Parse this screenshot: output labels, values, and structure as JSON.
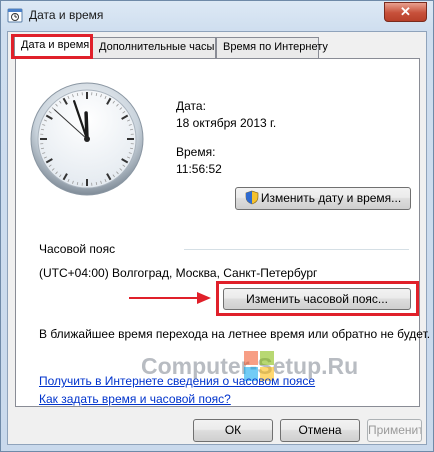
{
  "window": {
    "title": "Дата и время",
    "close_label": "✕"
  },
  "tabs": [
    {
      "label": "Дата и время",
      "active": true
    },
    {
      "label": "Дополнительные часы",
      "active": false
    },
    {
      "label": "Время по Интернету",
      "active": false
    }
  ],
  "clock": {
    "time": "11:56:52",
    "hour": 11,
    "minute": 56,
    "second": 52
  },
  "date": {
    "label": "Дата:",
    "value": "18 октября 2013 г."
  },
  "time": {
    "label": "Время:",
    "value": "11:56:52"
  },
  "buttons": {
    "change_datetime": "Изменить дату и время...",
    "change_timezone": "Изменить часовой пояс...",
    "ok": "ОК",
    "cancel": "Отмена",
    "apply": "Применить"
  },
  "timezone": {
    "section_label": "Часовой пояс",
    "value": "(UTC+04:00) Волгоград, Москва, Санкт-Петербург",
    "dst_note": "В ближайшее время перехода на летнее время или обратно не будет."
  },
  "watermark": {
    "text": "Computer-Setup.Ru"
  },
  "links": {
    "timezone_info": "Получить в Интернете сведения о часовом поясе",
    "how_to_set": "Как задать время и часовой пояс?"
  },
  "colors": {
    "highlight_red": "#e0202a",
    "link_blue": "#0033cc",
    "arrow_red": "#e0202a"
  },
  "icons": {
    "title": "clock-calendar-icon",
    "shield": "uac-shield-icon"
  }
}
